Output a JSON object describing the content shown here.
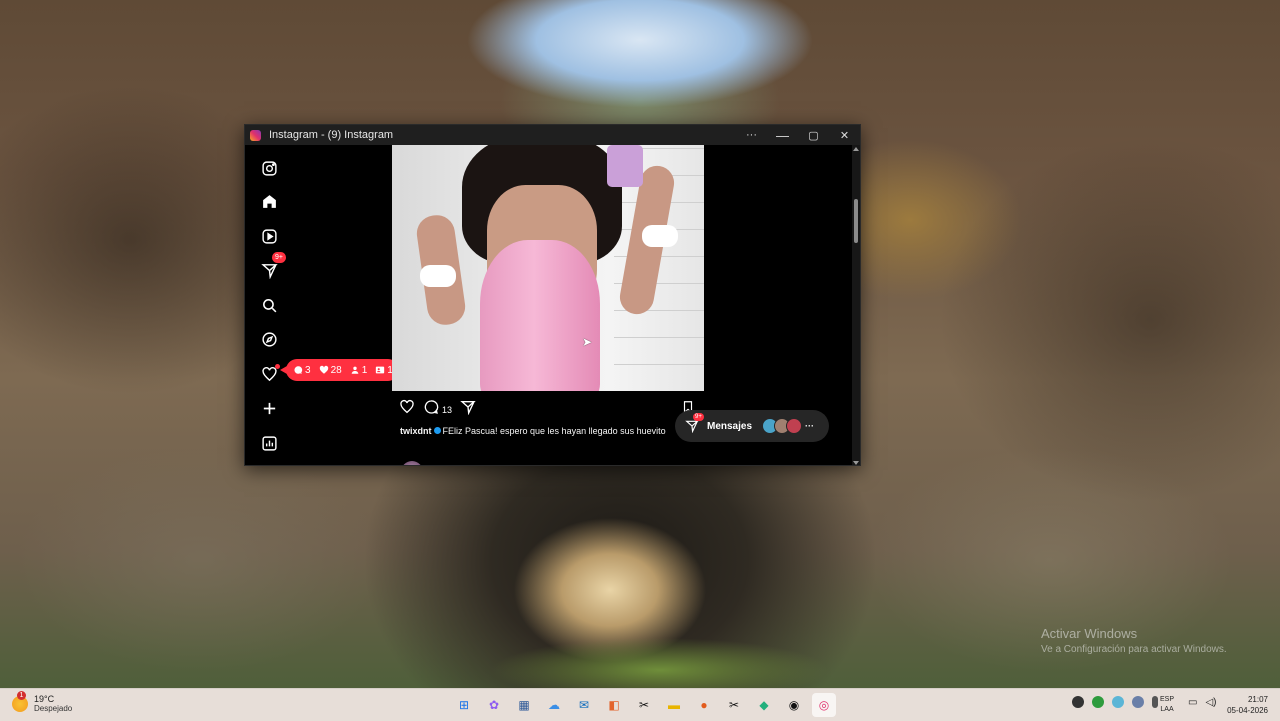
{
  "window": {
    "title": "Instagram - (9) Instagram",
    "controls": {
      "more": "···",
      "minimize": "—",
      "maximize": "▢",
      "close": "✕"
    }
  },
  "nav": {
    "items": [
      {
        "name": "instagram-logo-icon"
      },
      {
        "name": "home-icon"
      },
      {
        "name": "reels-icon"
      },
      {
        "name": "messages-icon",
        "badge": "9+"
      },
      {
        "name": "search-icon"
      },
      {
        "name": "explore-icon"
      },
      {
        "name": "notifications-icon"
      },
      {
        "name": "create-icon"
      },
      {
        "name": "insights-icon"
      }
    ]
  },
  "notifications_pill": {
    "comments": "3",
    "likes": "28",
    "follows": "1",
    "mentions": "1",
    "color": "#ff3040"
  },
  "post": {
    "comment_count": "13",
    "username": "twixdnt",
    "caption": "FEliz Pascua! espero que les hayan llegado sus huevito"
  },
  "messages_bar": {
    "label": "Mensajes",
    "badge": "9+",
    "more": "···"
  },
  "desktop": {
    "watermark_title": "Activar Windows",
    "watermark_subtitle": "Ve a Configuración para activar Windows."
  },
  "taskbar": {
    "weather_temp": "19°C",
    "weather_condition": "Despejado",
    "language_line1": "ESP",
    "language_line2": "LAA",
    "time": "21:07",
    "date": "05-04-2026"
  }
}
